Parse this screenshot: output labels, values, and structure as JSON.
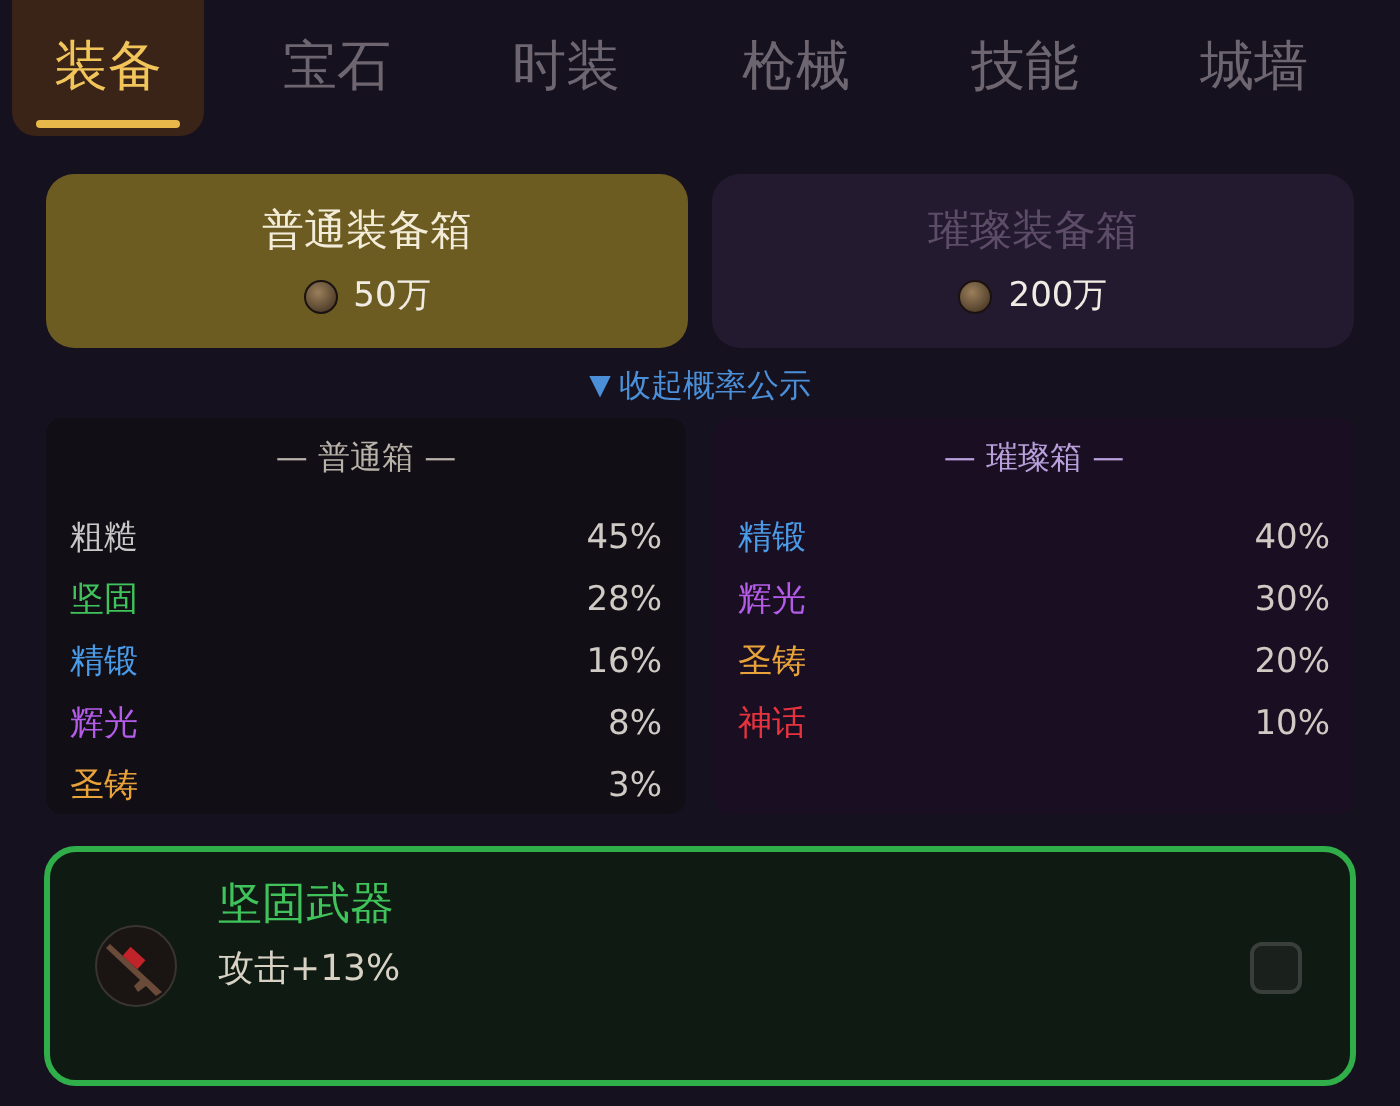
{
  "tabs": [
    {
      "label": "装备",
      "selected": true
    },
    {
      "label": "宝石",
      "selected": false
    },
    {
      "label": "时装",
      "selected": false
    },
    {
      "label": "枪械",
      "selected": false
    },
    {
      "label": "技能",
      "selected": false
    },
    {
      "label": "城墙",
      "selected": false
    }
  ],
  "boxes": [
    {
      "name": "普通装备箱",
      "price": "50万",
      "selected": true
    },
    {
      "name": "璀璨装备箱",
      "price": "200万",
      "selected": false
    }
  ],
  "toggle": {
    "icon": "▼",
    "label": "收起概率公示"
  },
  "tables": [
    {
      "title": "— 普通箱 —",
      "rows": [
        {
          "name": "粗糙",
          "rate": "45%",
          "color": "#c8c8c8"
        },
        {
          "name": "坚固",
          "rate": "28%",
          "color": "#3fc35a"
        },
        {
          "name": "精锻",
          "rate": "16%",
          "color": "#4a9be8"
        },
        {
          "name": "辉光",
          "rate": "8%",
          "color": "#b45be8"
        },
        {
          "name": "圣铸",
          "rate": "3%",
          "color": "#e8a23a"
        }
      ]
    },
    {
      "title": "— 璀璨箱 —",
      "rows": [
        {
          "name": "精锻",
          "rate": "40%",
          "color": "#4a9be8"
        },
        {
          "name": "辉光",
          "rate": "30%",
          "color": "#b45be8"
        },
        {
          "name": "圣铸",
          "rate": "20%",
          "color": "#e8a23a"
        },
        {
          "name": "神话",
          "rate": "10%",
          "color": "#e8333f"
        }
      ]
    }
  ],
  "result": {
    "name": "坚固武器",
    "stat": "攻击+13%",
    "color": "#3fc35a",
    "checkbox": {
      "checked": false
    }
  }
}
